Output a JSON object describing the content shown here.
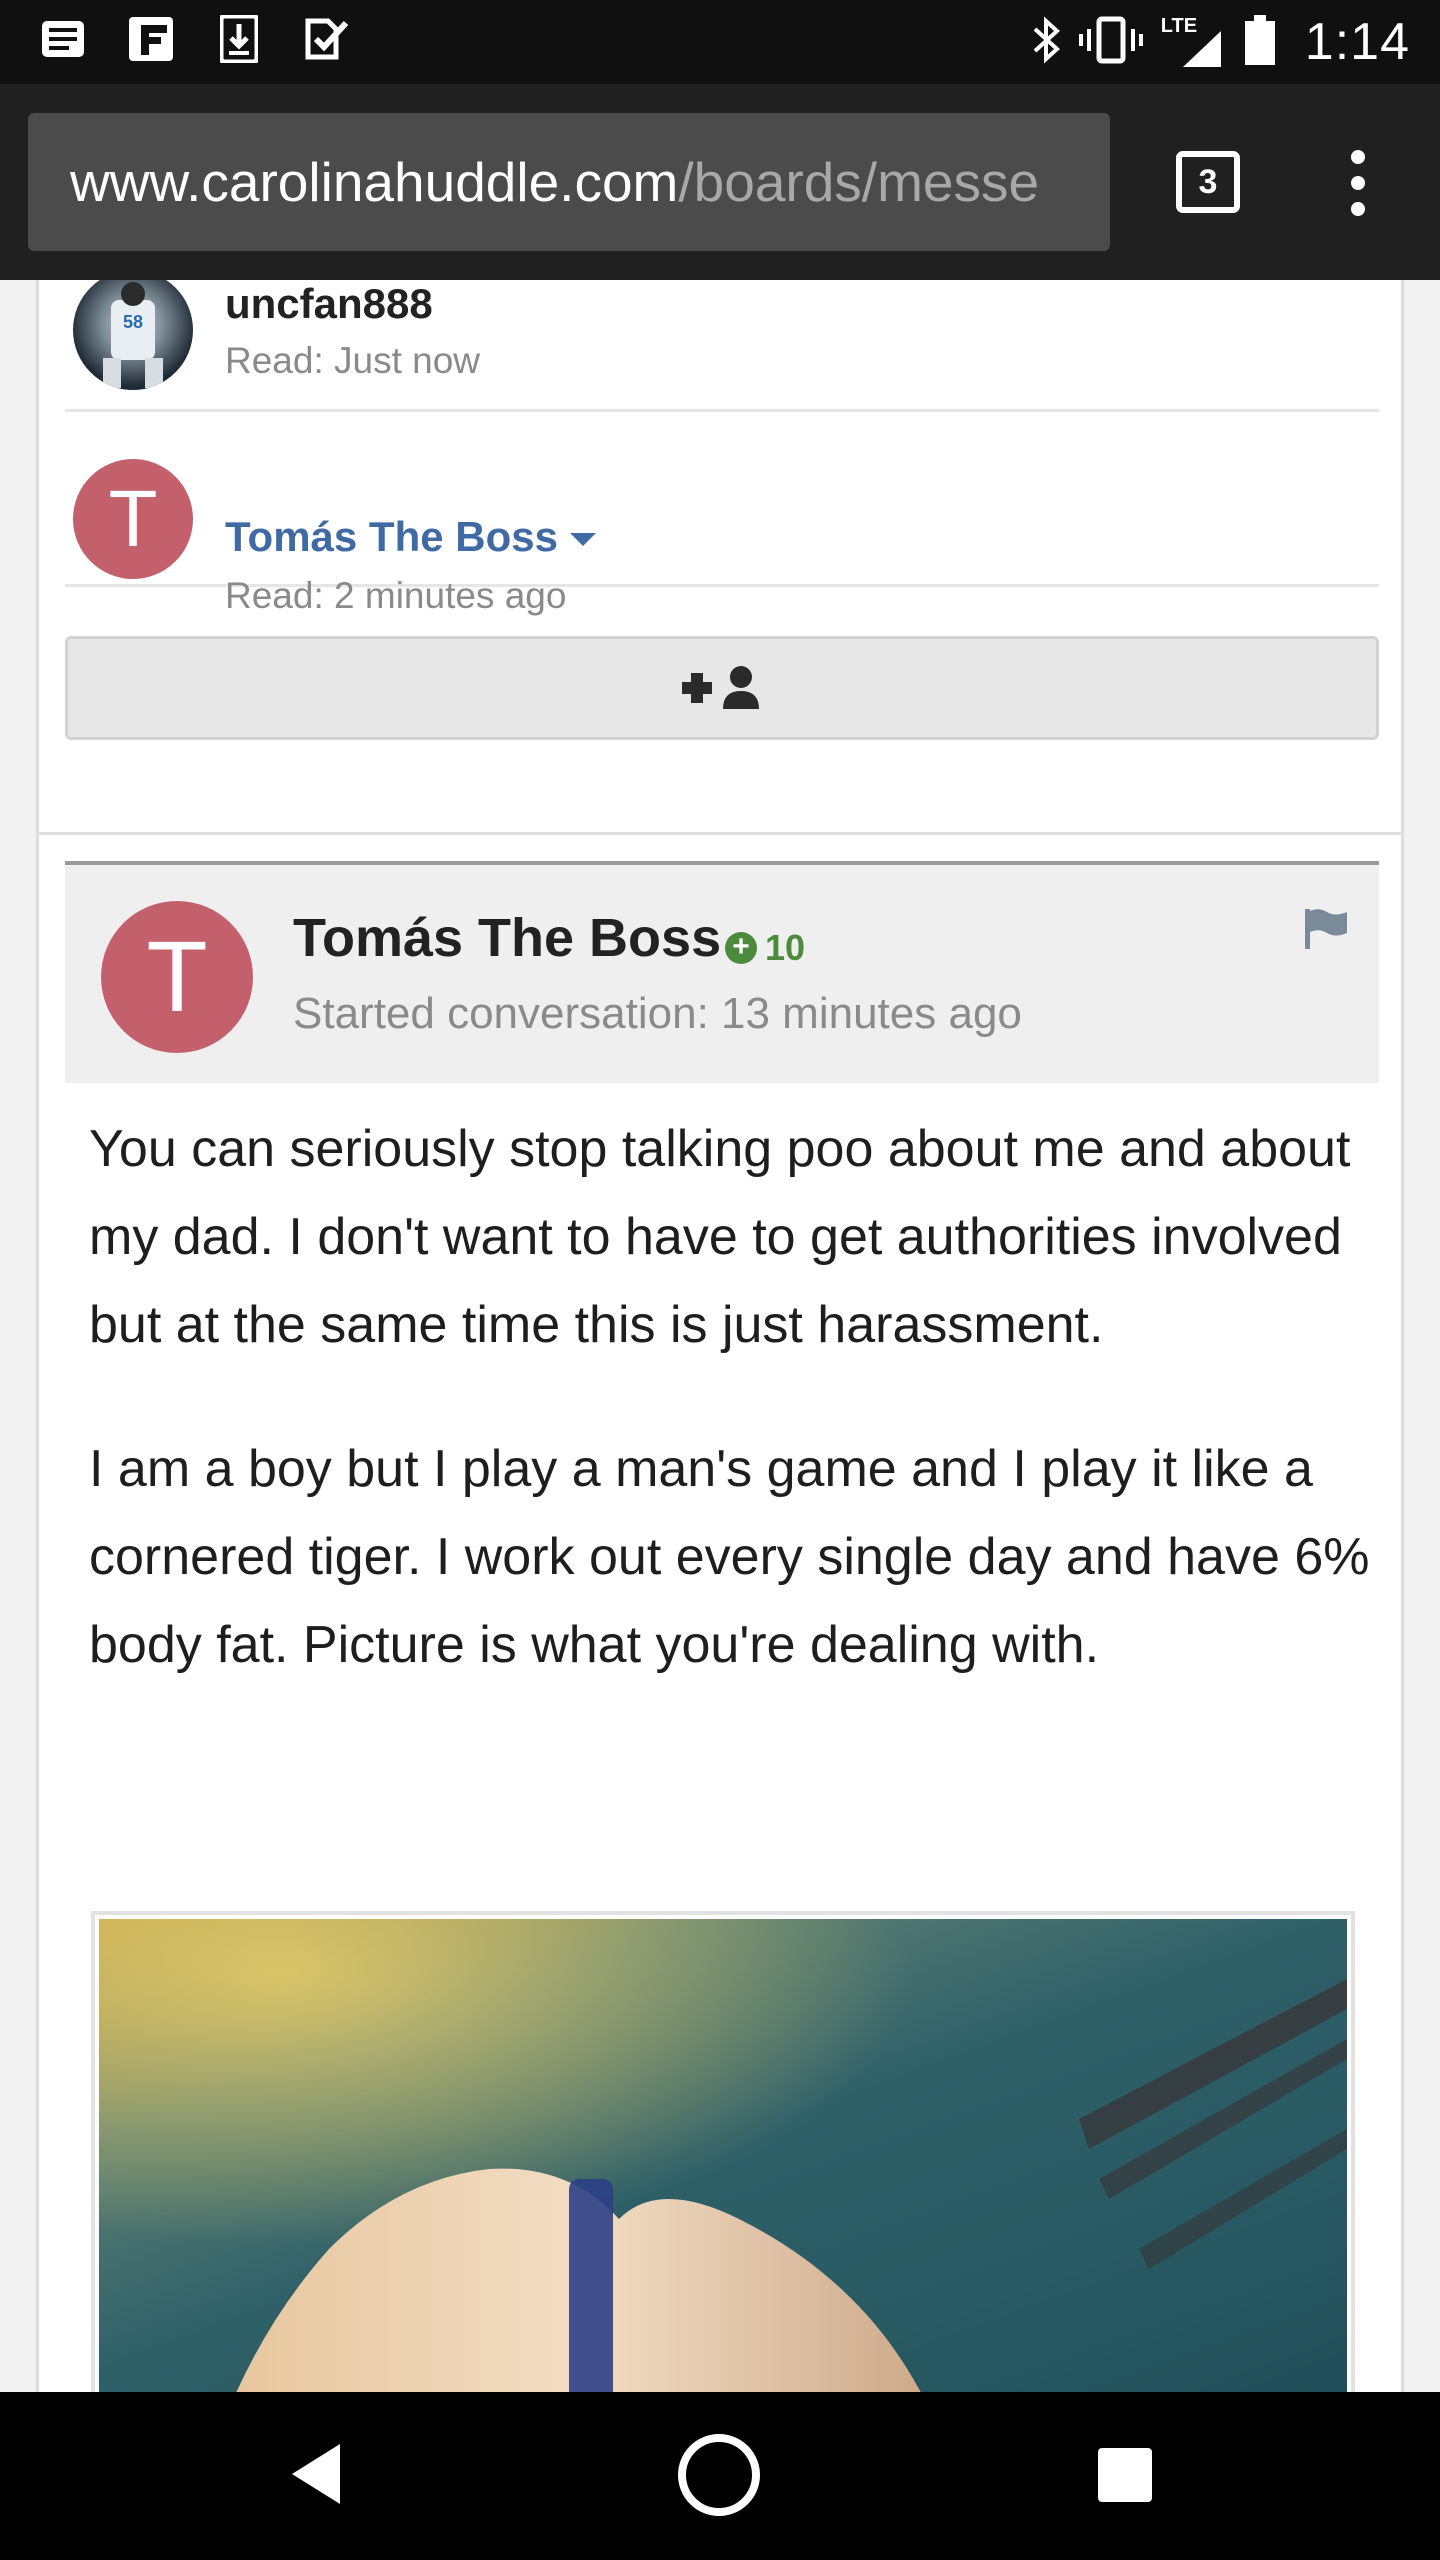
{
  "status_bar": {
    "time": "1:14",
    "network": "LTE",
    "left_icons": [
      "newspaper-icon",
      "flipboard-icon",
      "download-icon",
      "tasks-icon"
    ],
    "right_icons": [
      "bluetooth-icon",
      "vibrate-icon",
      "signal-icon",
      "battery-icon"
    ]
  },
  "browser": {
    "url_host": "www.carolinahuddle.com",
    "url_path": "/boards/messe",
    "tab_count": "3"
  },
  "readers": [
    {
      "name": "uncfan888",
      "read": "Read: Just now"
    },
    {
      "name": "Tomás The Boss",
      "avatar_letter": "T",
      "read": "Read: 2 minutes ago"
    }
  ],
  "post": {
    "avatar_letter": "T",
    "author": "Tomás The Boss",
    "reputation": "10",
    "started": "Started conversation: 13 minutes ago",
    "paragraphs": [
      "You can seriously stop talking poo about me and about my dad. I don't want to have to get authorities involved but at the same time this is just harassment.",
      "I am a boy but I play a man's game and I play it like a cornered tiger. I work out every single day and have 6% body fat. Picture is what you're dealing with."
    ]
  },
  "colors": {
    "avatar_bg": "#c4606b",
    "link_blue": "#3f6aa3",
    "rep_green": "#4c8a3e"
  }
}
